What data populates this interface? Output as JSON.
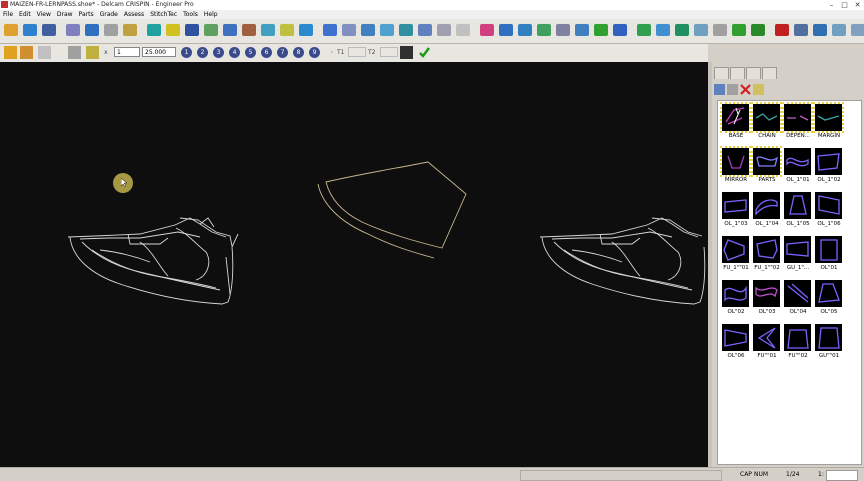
{
  "window": {
    "title": "MAIZEN-FR-LERNPASS.shoe* - Delcam CRISPIN - Engineer Pro"
  },
  "menu": [
    "File",
    "Edit",
    "View",
    "Draw",
    "Parts",
    "Grade",
    "Assess",
    "StitchTec",
    "Tools",
    "Help"
  ],
  "toolbar1_icons": [
    "new-icon",
    "open-icon",
    "save-icon",
    "undo-icon",
    "redo-icon",
    "copy-icon",
    "paste-icon",
    "point-icon",
    "line-icon",
    "curve-icon",
    "rectangle-icon",
    "circle-icon",
    "ruler-icon",
    "measure-icon",
    "grid-icon",
    "help-icon",
    "pen-icon",
    "zigzag-icon",
    "spline-icon",
    "offset-icon",
    "stitch-icon",
    "align-icon",
    "blend-icon",
    "notch-icon",
    "draw-icon",
    "eraser-icon",
    "trim-icon",
    "corner-icon",
    "angle-icon",
    "arc-icon",
    "split-icon",
    "mirror-icon",
    "chart-icon",
    "home-icon",
    "info-icon",
    "measure2-icon",
    "pattern-icon",
    "refresh-icon",
    "export-icon",
    "margin-icon",
    "user-icon",
    "layer-icon",
    "grade-icon",
    "settings-icon"
  ],
  "toolbar2": {
    "scale_label": "x",
    "scale_value": "1",
    "zoom_value": "25.000",
    "buttons": [
      "1",
      "2",
      "3",
      "4",
      "5",
      "6",
      "7",
      "8",
      "9"
    ],
    "t1_label": "T1",
    "t2_label": "T2"
  },
  "panel": {
    "items": [
      {
        "label": "BASE",
        "highlight": true,
        "color": "#c040c0"
      },
      {
        "label": "CHAIN",
        "highlight": true,
        "color": "#40a0a0"
      },
      {
        "label": "DEPEN...",
        "highlight": true,
        "color": "#c060c0"
      },
      {
        "label": "MARGIN",
        "highlight": true,
        "color": "#40a0a0"
      },
      {
        "label": "MIRROR",
        "highlight": true,
        "color": "#a040c0"
      },
      {
        "label": "PARTS",
        "highlight": true,
        "color": "#8080ff"
      },
      {
        "label": "OL_1\"01",
        "highlight": false,
        "color": "#8060ff"
      },
      {
        "label": "OL_1\"02",
        "highlight": false,
        "color": "#8060ff"
      },
      {
        "label": "OL_1\"03",
        "highlight": false,
        "color": "#8060ff"
      },
      {
        "label": "OL_1\"04",
        "highlight": false,
        "color": "#8060ff"
      },
      {
        "label": "OL_1\"05",
        "highlight": false,
        "color": "#8060ff"
      },
      {
        "label": "OL_1\"06",
        "highlight": false,
        "color": "#8060ff"
      },
      {
        "label": "FU_1\"\"01",
        "highlight": false,
        "color": "#8060ff"
      },
      {
        "label": "FU_1\"\"02",
        "highlight": false,
        "color": "#8060ff"
      },
      {
        "label": "GU_1\"...",
        "highlight": false,
        "color": "#8060ff"
      },
      {
        "label": "OL\"01",
        "highlight": false,
        "color": "#8060ff"
      },
      {
        "label": "OL\"02",
        "highlight": false,
        "color": "#8060ff"
      },
      {
        "label": "OL\"03",
        "highlight": false,
        "color": "#c050d0"
      },
      {
        "label": "OL\"04",
        "highlight": false,
        "color": "#8060ff"
      },
      {
        "label": "OL\"05",
        "highlight": false,
        "color": "#8060ff"
      },
      {
        "label": "OL\"06",
        "highlight": false,
        "color": "#8060ff"
      },
      {
        "label": "FU\"\"01",
        "highlight": false,
        "color": "#8060ff"
      },
      {
        "label": "FU\"\"02",
        "highlight": false,
        "color": "#8060ff"
      },
      {
        "label": "GU\"\"01",
        "highlight": false,
        "color": "#8060ff"
      }
    ]
  },
  "status": {
    "cap": "CAP",
    "num": "NUM",
    "page": "1/24",
    "zoom": "1:"
  },
  "colors": {
    "canvas": "#0e0e0e",
    "shoe_line": "#d8d8d8",
    "last_line": "#c8b890",
    "cursor": "#b8a84a"
  }
}
